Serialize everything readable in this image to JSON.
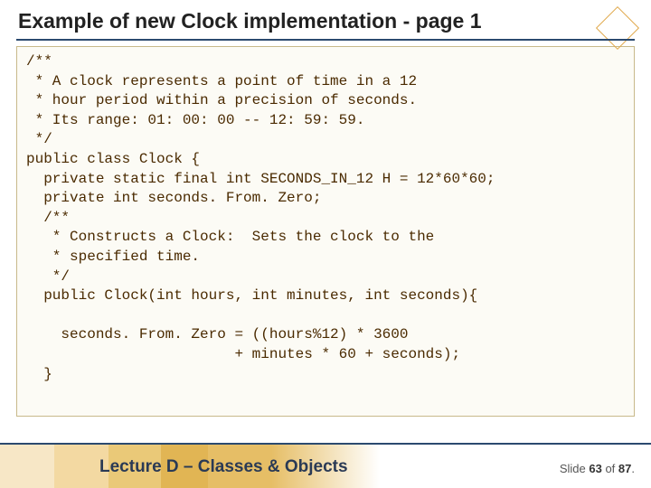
{
  "title": "Example of new Clock implementation - page 1",
  "code": "/**\n * A clock represents a point of time in a 12\n * hour period within a precision of seconds.\n * Its range: 01: 00: 00 -- 12: 59: 59.\n */\npublic class Clock {\n  private static final int SECONDS_IN_12 H = 12*60*60;\n  private int seconds. From. Zero;\n  /**\n   * Constructs a Clock:  Sets the clock to the\n   * specified time.\n   */\n  public Clock(int hours, int minutes, int seconds){\n\n    seconds. From. Zero = ((hours%12) * 3600\n                        + minutes * 60 + seconds);\n  }",
  "footer": {
    "lecture": "Lecture D – Classes & Objects",
    "slide_label_prefix": "Slide ",
    "slide_current": "63",
    "slide_of": " of ",
    "slide_total": "87",
    "slide_suffix": "."
  }
}
